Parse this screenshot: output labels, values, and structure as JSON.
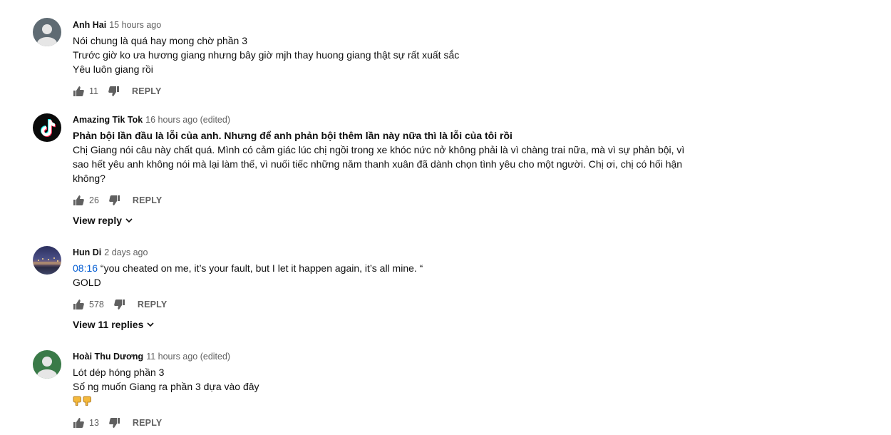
{
  "comments": [
    {
      "author": "Anh Hai",
      "time": "15 hours ago",
      "lines": [
        "Nói chung là quá hay mong chờ phần 3",
        "Trước giờ ko ưa hương giang nhưng bây giờ mjh thay huong giang thật sự rất xuất sắc",
        "Yêu luôn giang rồi"
      ],
      "likes": "11",
      "reply_label": "REPLY"
    },
    {
      "author": "Amazing Tik Tok",
      "time": "16 hours ago (edited)",
      "bold_line": "Phản bội lần đầu là lỗi của anh. Nhưng để anh phản bội thêm lần này nữa thì là lỗi của tôi rồi",
      "lines": [
        "Chị Giang nói câu này chất quá. Mình có cảm giác lúc chị ngồi trong xe khóc nức nở không phải là vì chàng trai nữa, mà vì sự phản bội, vì",
        "sao hết yêu anh không nói mà lại làm thế, vì nuối tiếc những năm thanh xuân đã dành chọn tình yêu cho một người. Chị ơi, chị có hối hận",
        "không?"
      ],
      "likes": "26",
      "reply_label": "REPLY",
      "view_replies": "View reply"
    },
    {
      "author": "Hun Di",
      "time": "2 days ago",
      "timestamp": "08:16",
      "first_line": " “you cheated on me, it’s your fault, but I let it happen again, it’s all mine. “",
      "lines": [
        "GOLD"
      ],
      "likes": "578",
      "reply_label": "REPLY",
      "view_replies": "View 11 replies"
    },
    {
      "author": "Hoài Thu Dương",
      "time": "11 hours ago (edited)",
      "lines": [
        "Lót dép hóng phần 3",
        "Số ng muốn Giang ra phần 3 dựa vào đây"
      ],
      "emoji_line": "👇👇",
      "likes": "13",
      "reply_label": "REPLY"
    }
  ],
  "icons": {
    "like": "thumb-up-icon",
    "dislike": "thumb-down-icon",
    "expand": "chevron-down-icon",
    "pointing": "pointing-down-icon"
  },
  "colors": {
    "link": "#065fd4",
    "muted": "#606060"
  }
}
